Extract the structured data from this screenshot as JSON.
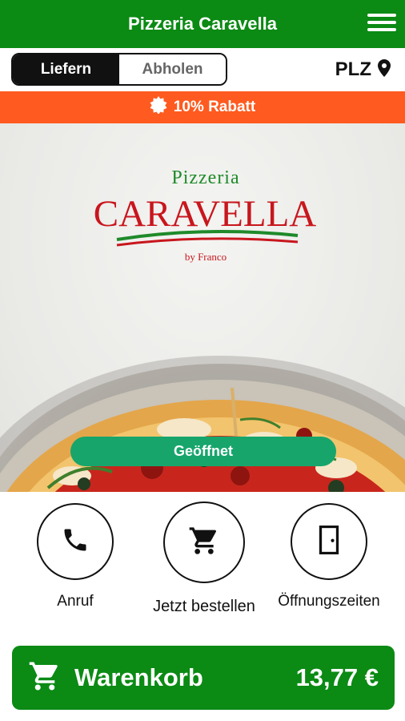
{
  "header": {
    "title": "Pizzeria Caravella",
    "menu_icon": "hamburger-icon"
  },
  "order_mode": {
    "options": [
      "Liefern",
      "Abholen"
    ],
    "selected": "Liefern"
  },
  "plz": {
    "label": "PLZ",
    "icon": "location-pin-icon"
  },
  "promo": {
    "text": "10% Rabatt",
    "icon": "badge-icon",
    "color": "#ff5a1f"
  },
  "logo": {
    "top": "Pizzeria",
    "main": "CARAVELLA",
    "sub": "by Franco"
  },
  "status": {
    "label": "Geöffnet",
    "color": "#17a56c"
  },
  "actions": [
    {
      "label": "Anruf",
      "icon": "phone-icon"
    },
    {
      "label": "Jetzt bestellen",
      "icon": "cart-icon"
    },
    {
      "label": "Öffnungszeiten",
      "icon": "door-icon"
    }
  ],
  "cart": {
    "label": "Warenkorb",
    "total": "13,77 €",
    "icon": "cart-icon"
  },
  "colors": {
    "brand_green": "#0b8a14",
    "accent_orange": "#ff5a1f",
    "logo_red": "#c8161d"
  }
}
